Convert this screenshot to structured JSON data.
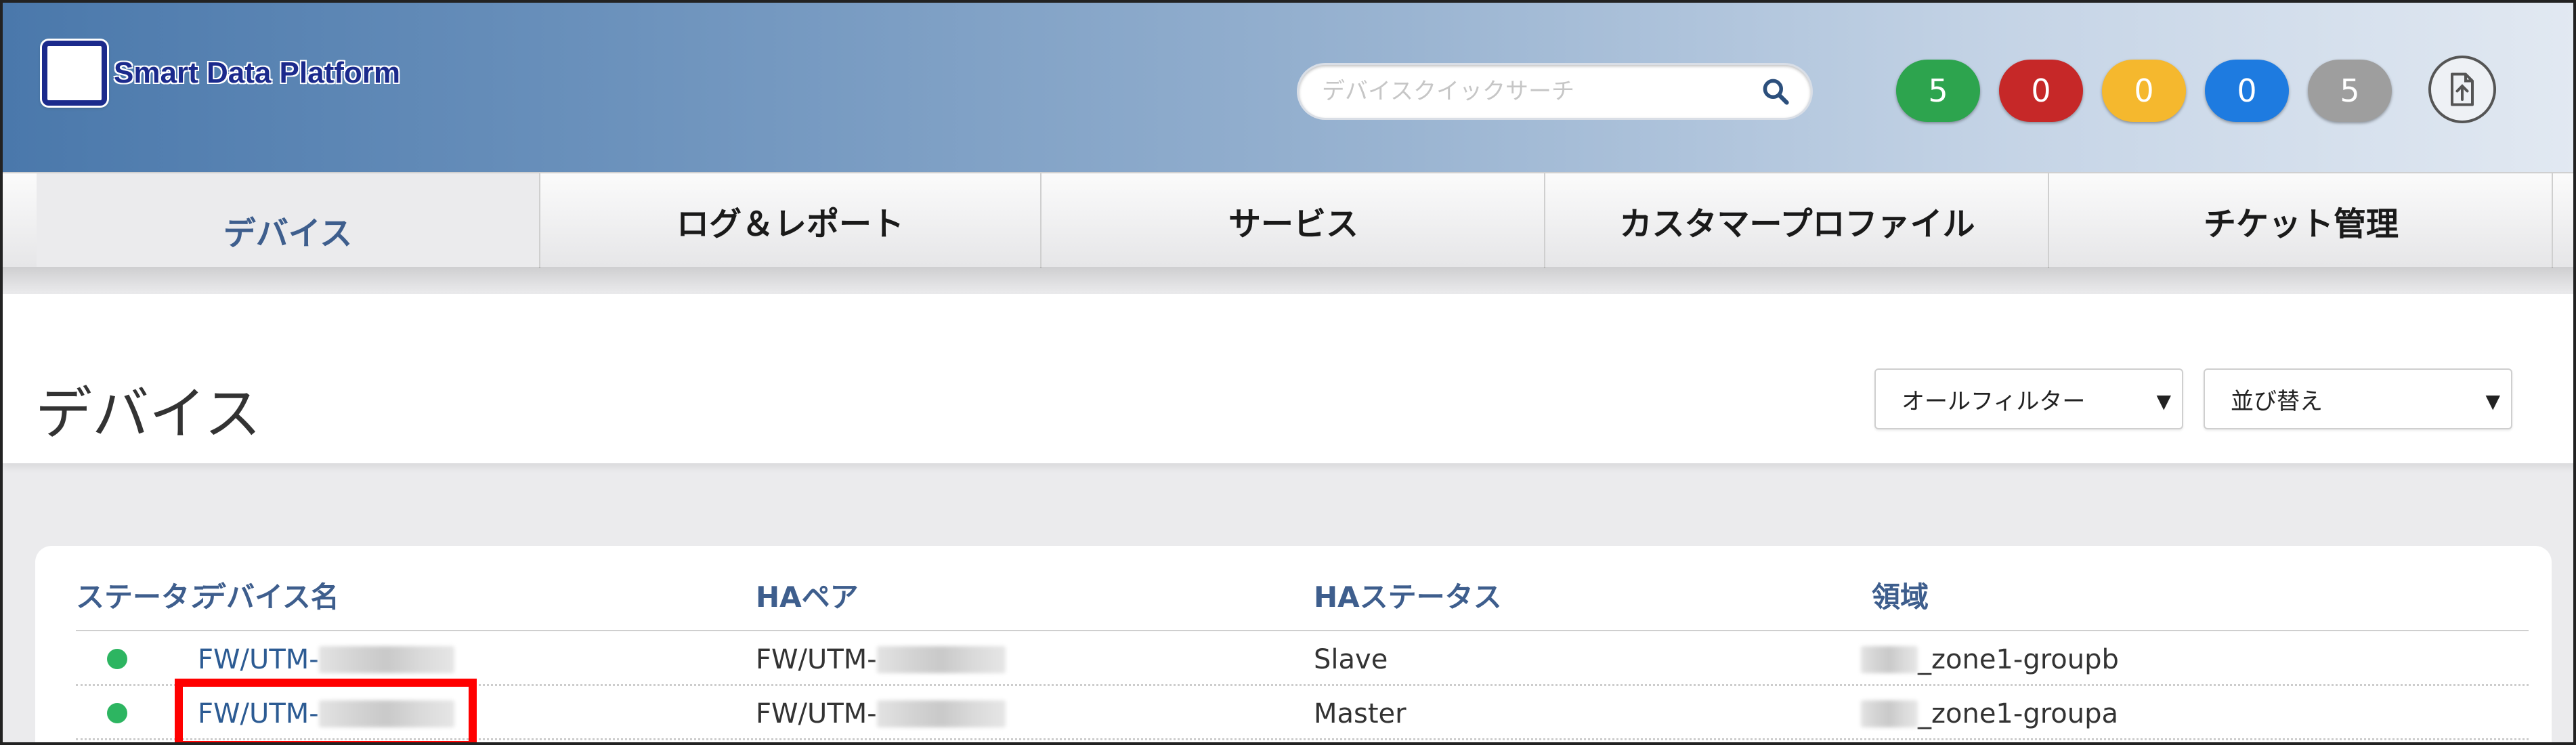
{
  "app": {
    "logo_text": "Smart Data Platform"
  },
  "search": {
    "placeholder": "デバイスクイックサーチ",
    "value": ""
  },
  "badges": [
    {
      "value": "5",
      "color": "#2da44e"
    },
    {
      "value": "0",
      "color": "#c62828"
    },
    {
      "value": "0",
      "color": "#f5b82e"
    },
    {
      "value": "0",
      "color": "#1e7be0"
    },
    {
      "value": "5",
      "color": "#9e9e9e"
    }
  ],
  "nav": {
    "tabs": [
      {
        "label": "デバイス",
        "active": true
      },
      {
        "label": "ログ＆レポート",
        "active": false
      },
      {
        "label": "サービス",
        "active": false
      },
      {
        "label": "カスタマープロファイル",
        "active": false
      },
      {
        "label": "チケット管理",
        "active": false
      }
    ]
  },
  "page": {
    "title": "デバイス",
    "filter_select": "オールフィルター",
    "sort_select": "並び替え"
  },
  "table": {
    "headers": [
      "ステータス",
      "デバイス名",
      "HAペア",
      "HAステータス",
      "領域"
    ],
    "rows": [
      {
        "status": "green",
        "device": "FW/UTM-",
        "ha_pair": "FW/UTM-",
        "ha_status": "Slave",
        "region": "_zone1-groupb"
      },
      {
        "status": "green",
        "device": "FW/UTM-",
        "ha_pair": "FW/UTM-",
        "ha_status": "Master",
        "region": "_zone1-groupa"
      }
    ]
  },
  "colors": {
    "accent": "#3e5e8d",
    "link": "#2c5b93",
    "status_ok": "#2db561",
    "highlight": "#ff0000"
  }
}
